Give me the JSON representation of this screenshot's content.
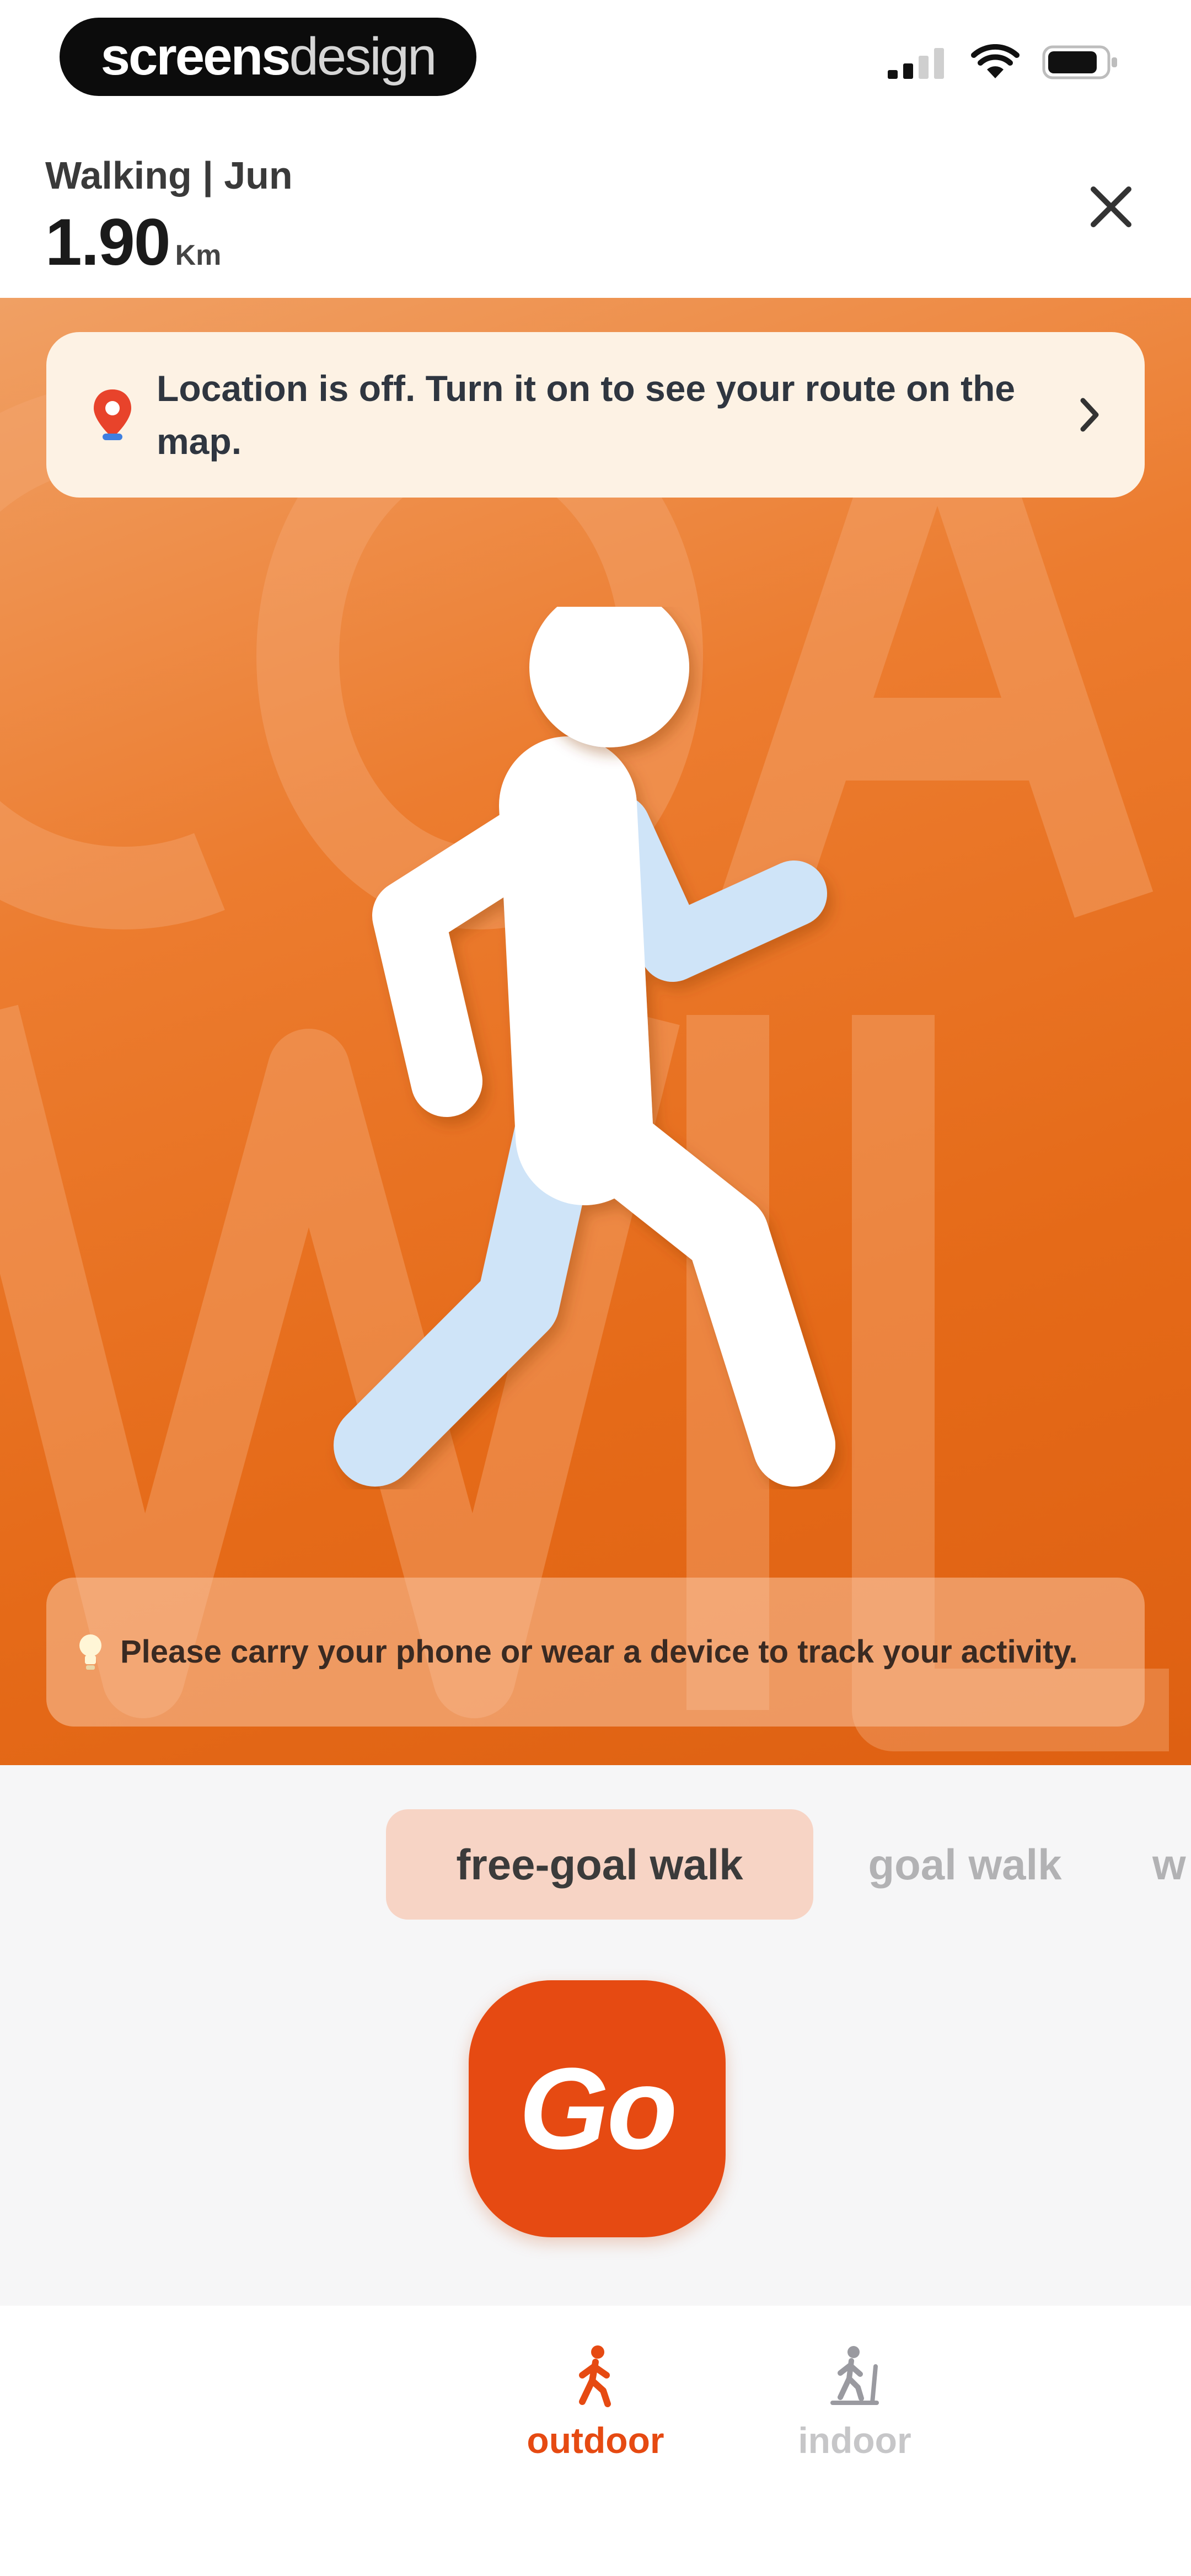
{
  "status_bar": {
    "brand_bold": "screens",
    "brand_light": "design"
  },
  "header": {
    "activity_label": "Walking | Jun",
    "distance_value": "1.90",
    "distance_unit": "Km"
  },
  "hero": {
    "location_banner": "Location is off. Turn it on to see your route on the map.",
    "tip": "Please carry your phone or wear a device to track your activity."
  },
  "goal_tabs": [
    {
      "label": "free-goal walk",
      "active": true
    },
    {
      "label": "goal walk",
      "active": false
    },
    {
      "label": "w",
      "active": false
    }
  ],
  "go_button": {
    "label": "Go"
  },
  "bottom_nav": {
    "items": [
      {
        "label": "outdoor",
        "active": true
      },
      {
        "label": "indoor",
        "active": false
      }
    ]
  },
  "colors": {
    "accent": "#e64a12",
    "hero_orange": "#ec7c2f",
    "active_tab_bg": "#f7d4c5",
    "banner_bg": "#fdf2e4"
  },
  "icons": {
    "status": [
      "cellular-signal-icon",
      "wifi-icon",
      "battery-icon"
    ],
    "close": "close-icon",
    "location": "location-pin-icon",
    "chevron": "chevron-right-icon",
    "tip": "lightbulb-icon",
    "hero": "walking-person-icon",
    "outdoor": "outdoor-walker-icon",
    "indoor": "indoor-treadmill-icon"
  }
}
